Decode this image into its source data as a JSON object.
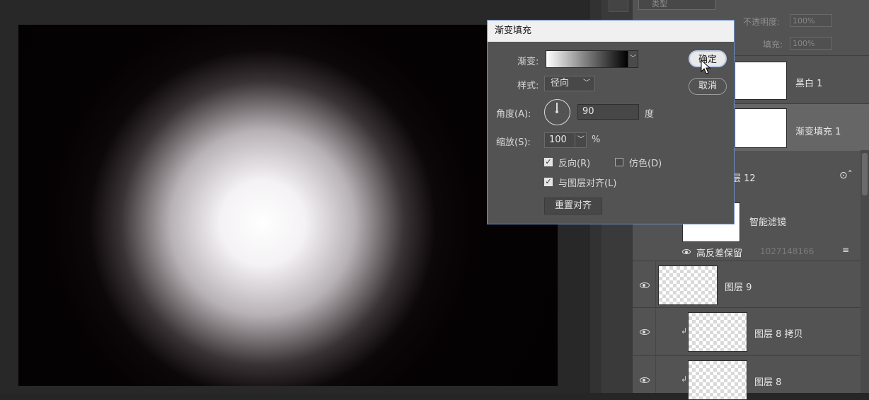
{
  "dialog": {
    "title": "渐变填充",
    "gradient_label": "渐变:",
    "style_label": "样式:",
    "style_value": "径向",
    "angle_label": "角度(A):",
    "angle_value": "90",
    "angle_unit": "度",
    "scale_label": "缩放(S):",
    "scale_value": "100",
    "scale_unit": "%",
    "reverse_label": "反向(R)",
    "reverse_checked": true,
    "dither_label": "仿色(D)",
    "dither_checked": false,
    "align_label": "与图层对齐(L)",
    "align_checked": true,
    "reset_align_label": "重置对齐",
    "ok_label": "确定",
    "cancel_label": "取消"
  },
  "layers_panel": {
    "search_placeholder": "类型",
    "opacity_label": "不透明度:",
    "opacity_value": "100%",
    "fill_label": "填充:",
    "fill_value": "100%",
    "layers": [
      {
        "name": "黑白 1",
        "visible": true,
        "selected": false
      },
      {
        "name": "渐变填充 1",
        "visible": true,
        "selected": true
      },
      {
        "name": "层 12",
        "visible": true,
        "selected": false
      },
      {
        "name": "智能滤镜",
        "visible": true,
        "selected": false
      },
      {
        "name": "高反差保留",
        "visible": true,
        "selected": false
      },
      {
        "name": "图层 9",
        "visible": true,
        "selected": false
      },
      {
        "name": "图层 8 拷贝",
        "visible": true,
        "selected": false,
        "clipped": true
      },
      {
        "name": "图层 8",
        "visible": true,
        "selected": false,
        "clipped": true
      }
    ],
    "watermark": "1027148166"
  },
  "colors": {
    "dialog_border": "#6b8fc9",
    "panel_bg": "#535353",
    "selected_row": "#666666"
  }
}
